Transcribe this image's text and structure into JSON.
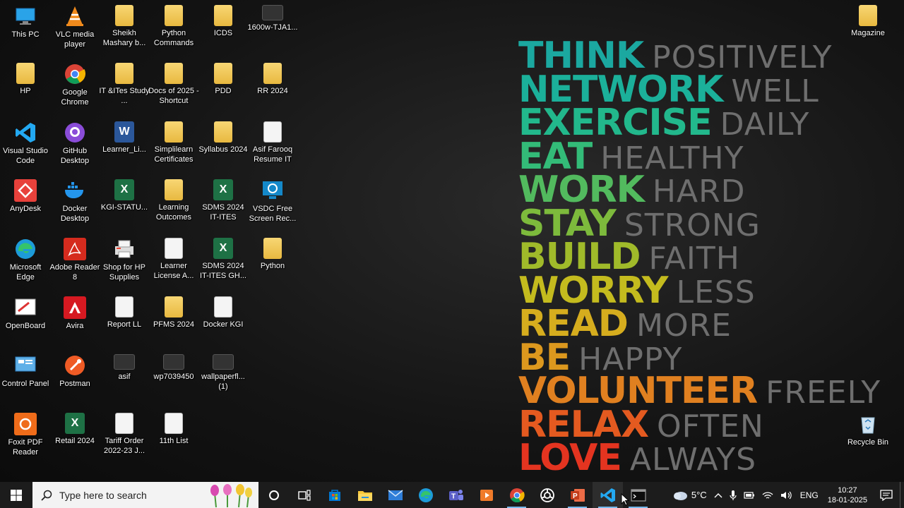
{
  "desktop_icons": [
    {
      "label": "This PC",
      "icon": "monitor-icon"
    },
    {
      "label": "VLC media player",
      "icon": "vlc-icon"
    },
    {
      "label": "Sheikh Mashary b...",
      "icon": "folder-icon"
    },
    {
      "label": "Python Commands",
      "icon": "folder-icon"
    },
    {
      "label": "ICDS",
      "icon": "folder-icon"
    },
    {
      "label": "1600w-TJA1...",
      "icon": "image-icon"
    },
    {
      "label": "HP",
      "icon": "user-folder-icon"
    },
    {
      "label": "Google Chrome",
      "icon": "chrome-icon"
    },
    {
      "label": "IT &ITes Study ...",
      "icon": "folder-icon"
    },
    {
      "label": "Docs of 2025 - Shortcut",
      "icon": "folder-icon"
    },
    {
      "label": "PDD",
      "icon": "folder-icon"
    },
    {
      "label": "RR 2024",
      "icon": "folder-icon"
    },
    {
      "label": "Visual Studio Code",
      "icon": "vscode-icon"
    },
    {
      "label": "GitHub Desktop",
      "icon": "github-icon"
    },
    {
      "label": "Learner_Li...",
      "icon": "word-icon"
    },
    {
      "label": "Simplilearn Certificates",
      "icon": "folder-icon"
    },
    {
      "label": "Syllabus 2024",
      "icon": "folder-icon"
    },
    {
      "label": "Asif Farooq Resume IT",
      "icon": "document-icon"
    },
    {
      "label": "AnyDesk",
      "icon": "anydesk-icon"
    },
    {
      "label": "Docker Desktop",
      "icon": "docker-icon"
    },
    {
      "label": "KGI-STATU...",
      "icon": "excel-icon"
    },
    {
      "label": "Learning Outcomes",
      "icon": "folder-icon"
    },
    {
      "label": "SDMS 2024 IT-ITES",
      "icon": "excel-icon"
    },
    {
      "label": "VSDC Free Screen Rec...",
      "icon": "vsdc-icon"
    },
    {
      "label": "Microsoft Edge",
      "icon": "edge-icon"
    },
    {
      "label": "Adobe Reader 8",
      "icon": "pdf-icon"
    },
    {
      "label": "Shop for HP Supplies",
      "icon": "printer-icon"
    },
    {
      "label": "Learner License A...",
      "icon": "document-icon"
    },
    {
      "label": "SDMS 2024 IT-ITES GH...",
      "icon": "excel-icon"
    },
    {
      "label": "Python",
      "icon": "folder-icon"
    },
    {
      "label": "OpenBoard",
      "icon": "openboard-icon"
    },
    {
      "label": "Avira",
      "icon": "avira-icon"
    },
    {
      "label": "Report LL",
      "icon": "document-icon"
    },
    {
      "label": "PFMS 2024",
      "icon": "folder-icon"
    },
    {
      "label": "Docker KGI",
      "icon": "document-icon"
    },
    {
      "label": "Control Panel",
      "icon": "control-panel-icon"
    },
    {
      "label": "Postman",
      "icon": "postman-icon"
    },
    {
      "label": "asif",
      "icon": "image-icon"
    },
    {
      "label": "wp7039450",
      "icon": "image-icon"
    },
    {
      "label": "wallpaperfl... (1)",
      "icon": "image-icon"
    },
    {
      "label": "Foxit PDF Reader",
      "icon": "foxit-icon"
    },
    {
      "label": "Retail 2024",
      "icon": "excel-icon"
    },
    {
      "label": "Tariff Order 2022-23 J...",
      "icon": "document-icon"
    },
    {
      "label": "11th List",
      "icon": "document-icon"
    },
    {
      "label": "Magazine",
      "icon": "folder-icon"
    },
    {
      "label": "Recycle Bin",
      "icon": "recycle-bin-icon"
    }
  ],
  "wallpaper": [
    {
      "bold": "THINK",
      "light": "POSITIVELY",
      "color": "#1ba8a0"
    },
    {
      "bold": "NETWORK",
      "light": "WELL",
      "color": "#1bb09a"
    },
    {
      "bold": "EXERCISE",
      "light": "DAILY",
      "color": "#22b88c"
    },
    {
      "bold": "EAT",
      "light": "HEALTHY",
      "color": "#33bb78"
    },
    {
      "bold": "WORK",
      "light": "HARD",
      "color": "#52ba5e"
    },
    {
      "bold": "STAY",
      "light": "STRONG",
      "color": "#7dba3c"
    },
    {
      "bold": "BUILD",
      "light": "FAITH",
      "color": "#a0ba2a"
    },
    {
      "bold": "WORRY",
      "light": "LESS",
      "color": "#c4bb1e"
    },
    {
      "bold": "READ",
      "light": "MORE",
      "color": "#d6ad1e"
    },
    {
      "bold": "BE",
      "light": "HAPPY",
      "color": "#dc981e"
    },
    {
      "bold": "VOLUNTEER",
      "light": "FREELY",
      "color": "#e08020"
    },
    {
      "bold": "RELAX",
      "light": "OFTEN",
      "color": "#e45a20"
    },
    {
      "bold": "LOVE",
      "light": "ALWAYS",
      "color": "#e43420"
    }
  ],
  "taskbar": {
    "search_placeholder": "Type here to search",
    "apps": [
      "cortana-icon",
      "task-view-icon",
      "store-icon",
      "file-explorer-icon",
      "mail-icon",
      "edge-icon",
      "teams-icon",
      "media-player-icon",
      "chrome-icon",
      "chatgpt-icon",
      "powerpoint-icon",
      "vscode-icon",
      "terminal-icon"
    ]
  },
  "tray": {
    "weather": "5°C",
    "language": "ENG",
    "time": "10:27",
    "date": "18-01-2025"
  }
}
